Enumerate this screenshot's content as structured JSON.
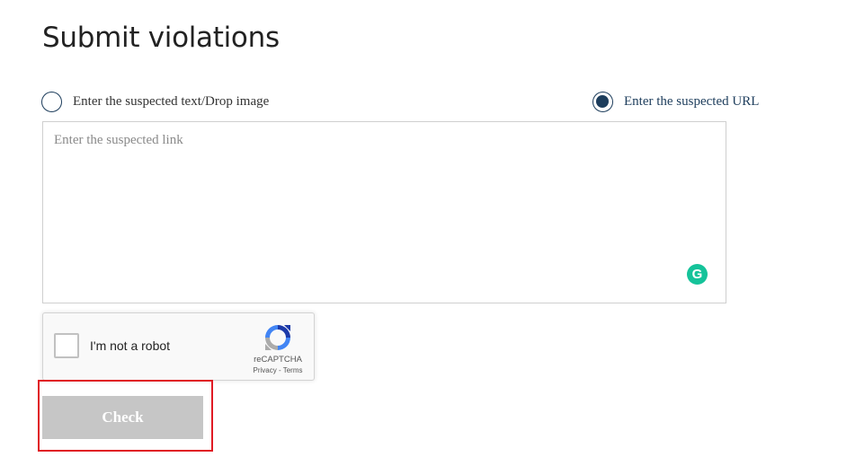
{
  "page": {
    "title": "Submit violations"
  },
  "mode_options": {
    "text_option": {
      "label": "Enter the suspected text/Drop image",
      "selected": false
    },
    "url_option": {
      "label": "Enter the suspected URL",
      "selected": true
    }
  },
  "link_input": {
    "value": "",
    "placeholder": "Enter the suspected link"
  },
  "recaptcha": {
    "label": "I'm not a robot",
    "brand": "reCAPTCHA",
    "privacy": "Privacy",
    "separator": "-",
    "terms": "Terms",
    "checked": false
  },
  "actions": {
    "check_label": "Check"
  },
  "colors": {
    "accent": "#1d3d5c",
    "button_disabled": "#c6c6c6",
    "highlight": "#e01b24",
    "grammarly": "#15c39a"
  }
}
